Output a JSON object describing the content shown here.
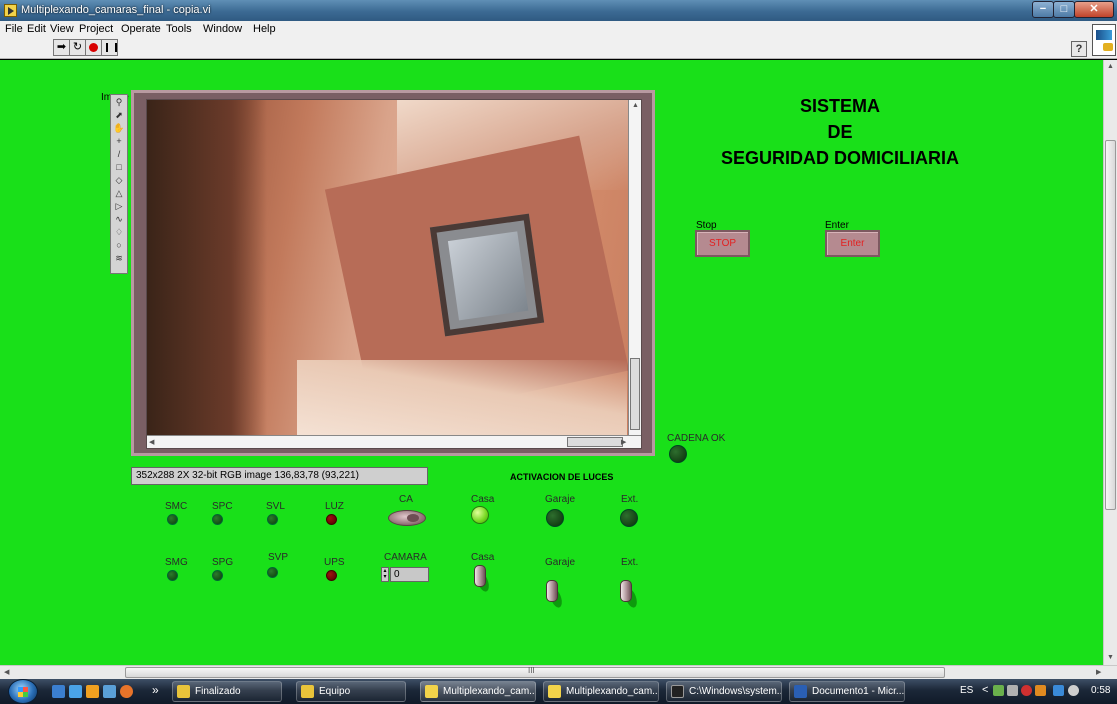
{
  "window": {
    "title": "Multiplexando_camaras_final - copia.vi",
    "min_glyph": "−",
    "max_glyph": "□",
    "close_glyph": "✕"
  },
  "menu": [
    "File",
    "Edit",
    "View",
    "Project",
    "Operate",
    "Tools",
    "Window",
    "Help"
  ],
  "help_glyph": "?",
  "image_display": {
    "label": "Image",
    "status": "352x288 2X 32-bit RGB image 136,83,78    (93,221)"
  },
  "panel_title": [
    "SISTEMA",
    "DE",
    "SEGURIDAD DOMICILIARIA"
  ],
  "buttons": {
    "stop_label": "Stop",
    "stop_text": "STOP",
    "enter_label": "Enter",
    "enter_text": "Enter"
  },
  "cadena_label": "CADENA OK",
  "section_title": "ACTIVACION DE LUCES",
  "indicators_row1": [
    "SMC",
    "SPC",
    "SVL",
    "LUZ"
  ],
  "indicators_row2": [
    "SMG",
    "SPG",
    "SVP",
    "UPS"
  ],
  "ca_label": "CA",
  "camara_label": "CAMARA",
  "camara_value": "0",
  "lights_row1": [
    "Casa",
    "Garaje",
    "Ext."
  ],
  "lights_row2": [
    "Casa",
    "Garaje",
    "Ext."
  ],
  "light_casa_on": true,
  "hscroll_grip": "III",
  "taskbar": {
    "tasks": [
      "Finalizado",
      "Equipo",
      "Multiplexando_cam...",
      "Multiplexando_cam...",
      "C:\\Windows\\system...",
      "Documento1 - Micr..."
    ],
    "chevron": "»",
    "lang": "ES",
    "tray_chevron": "<",
    "time": "0:58"
  }
}
